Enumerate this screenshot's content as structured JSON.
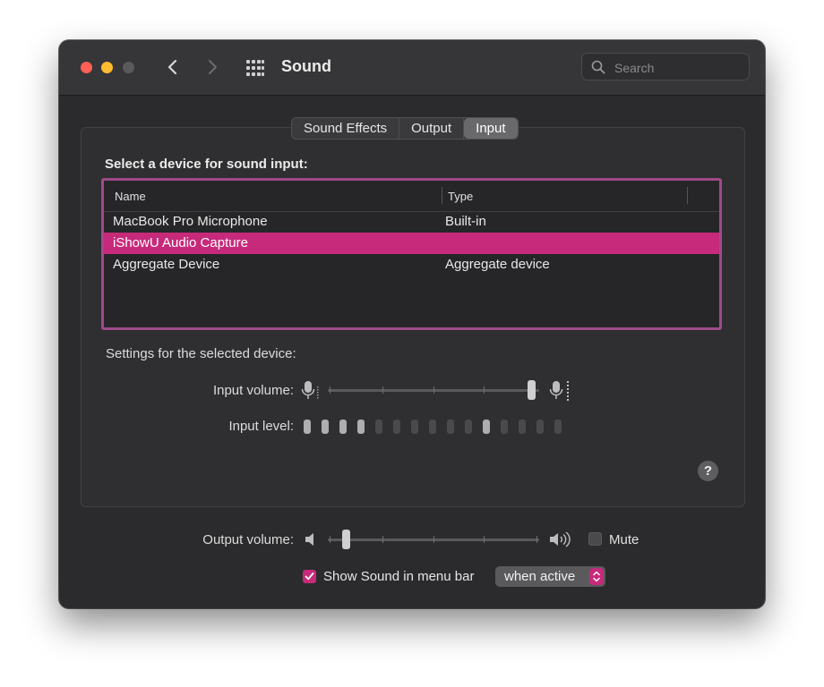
{
  "window": {
    "title": "Sound",
    "search_placeholder": "Search"
  },
  "tabs": [
    {
      "label": "Sound Effects",
      "active": false
    },
    {
      "label": "Output",
      "active": false
    },
    {
      "label": "Input",
      "active": true
    }
  ],
  "input_panel": {
    "heading": "Select a device for sound input:",
    "columns": [
      "Name",
      "Type"
    ],
    "devices": [
      {
        "name": "MacBook Pro Microphone",
        "type": "Built-in",
        "selected": false
      },
      {
        "name": "iShowU Audio Capture",
        "type": "",
        "selected": true
      },
      {
        "name": "Aggregate Device",
        "type": "Aggregate device",
        "selected": false
      }
    ],
    "settings_label": "Settings for the selected device:",
    "input_volume_label": "Input volume:",
    "input_volume_fraction": 1.0,
    "input_level_label": "Input level:",
    "input_level_segments": [
      true,
      true,
      true,
      true,
      false,
      false,
      false,
      false,
      false,
      false,
      true,
      false,
      false,
      false,
      false
    ]
  },
  "output": {
    "volume_label": "Output volume:",
    "volume_fraction": 0.07,
    "mute_label": "Mute",
    "mute_checked": false,
    "show_in_menu_bar_label": "Show Sound in menu bar",
    "show_in_menu_bar_checked": true,
    "menu_bar_option": "when active"
  },
  "colors": {
    "accent": "#c72a7a",
    "table_border": "#a04a8a",
    "close": "#ff5f57",
    "minimize": "#febc2e"
  }
}
